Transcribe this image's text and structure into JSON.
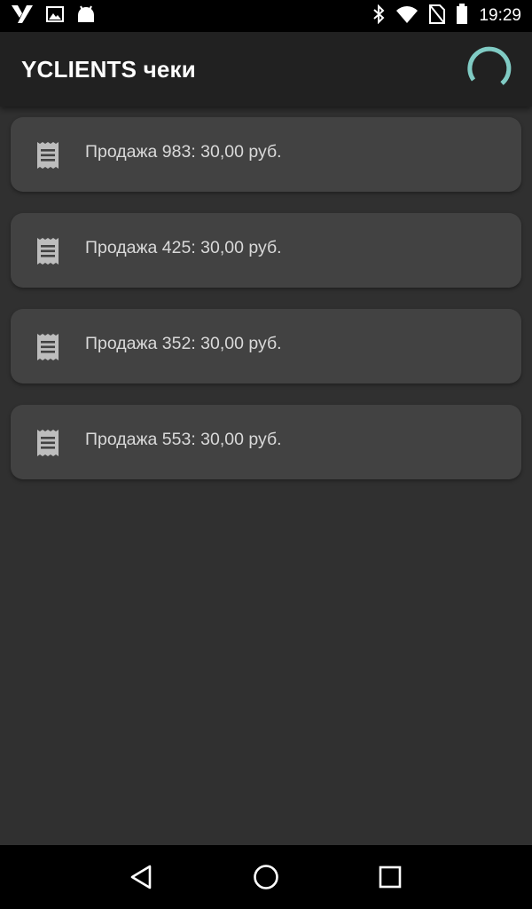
{
  "status_bar": {
    "time": "19:29",
    "left_icons": [
      "yclients-logo-icon",
      "image-notification-icon",
      "android-debug-icon"
    ],
    "right_icons": [
      "bluetooth-icon",
      "wifi-icon",
      "no-sim-icon",
      "battery-icon"
    ]
  },
  "app_bar": {
    "title": "YCLIENTS чеки",
    "spinner_color": "#80cbc4"
  },
  "receipts": [
    {
      "label": "Продажа 983: 30,00 руб.",
      "icon": "receipt-icon"
    },
    {
      "label": "Продажа 425: 30,00 руб.",
      "icon": "receipt-icon"
    },
    {
      "label": "Продажа 352: 30,00 руб.",
      "icon": "receipt-icon"
    },
    {
      "label": "Продажа 553: 30,00 руб.",
      "icon": "receipt-icon"
    }
  ],
  "nav_bar": {
    "buttons": [
      "back-icon",
      "home-icon",
      "recents-icon"
    ]
  },
  "colors": {
    "background": "#303030",
    "app_bar": "#212121",
    "card": "#424242",
    "accent": "#80cbc4"
  }
}
